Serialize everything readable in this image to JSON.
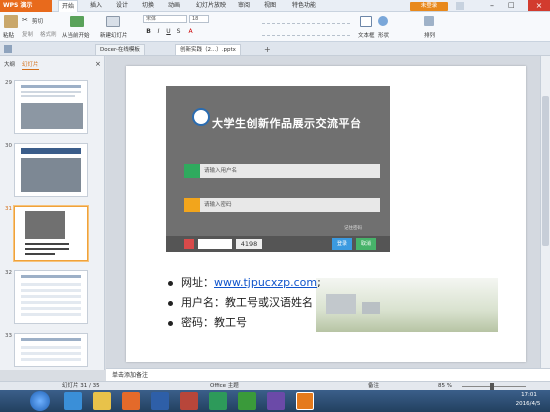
{
  "menubar": {
    "app_name": "WPS 演示",
    "items": [
      "开始",
      "插入",
      "设计",
      "切换",
      "动画",
      "幻灯片放映",
      "审阅",
      "视图",
      "特色功能"
    ],
    "login": "未登录"
  },
  "ribbon": {
    "paste": "粘贴",
    "cut": "剪切",
    "copy": "复制",
    "format_painter": "格式刷",
    "from_current": "从当前开始",
    "new_slide": "新建幻灯片",
    "font_name": "宋体",
    "font_size": "18",
    "textbox": "文本框",
    "shapes": "形状",
    "arrange": "排列"
  },
  "tabs": {
    "tab1": "Docer-在线模板",
    "tab2": "创新实践（2...）.pptx",
    "add": "+"
  },
  "leftpane": {
    "tab_outline": "大纲",
    "tab_slides": "幻灯片",
    "thumbs": [
      "29",
      "30",
      "31",
      "32",
      "33"
    ]
  },
  "slide": {
    "login_title": "大学生创新作品展示交流平台",
    "username_placeholder": "请输入用户名",
    "password_placeholder": "请输入密码",
    "remember": "记住密码",
    "captcha": "4198",
    "login_btn": "登录",
    "cancel_btn": "取消",
    "bullets": {
      "b1_label": "网址：",
      "b1_link": "www.tjpucxzp.com",
      "b1_end": ";",
      "b2": "用户名：教工号或汉语姓名",
      "b3": "密码：教工号"
    }
  },
  "notes": "单击添加备注",
  "status": {
    "slide_count": "幻灯片 31 / 35",
    "theme": "Office 主题",
    "notes_toggle": "备注",
    "zoom": "85 %"
  },
  "taskbar": {
    "time": "17:01",
    "date": "2016/4/5"
  }
}
